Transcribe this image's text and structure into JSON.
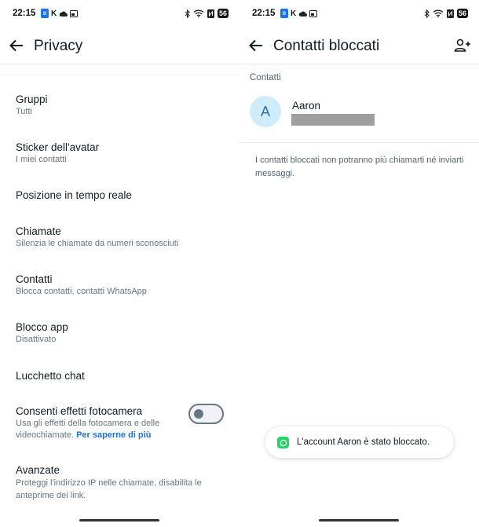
{
  "status_bar": {
    "time": "22:15",
    "battery": "56"
  },
  "left_screen": {
    "title": "Privacy",
    "items": [
      {
        "title": "Gruppi",
        "subtitle": "Tutti"
      },
      {
        "title": "Sticker dell'avatar",
        "subtitle": "I miei contatti"
      },
      {
        "title": "Posizione in tempo reale",
        "subtitle": ""
      },
      {
        "title": "Chiamate",
        "subtitle": "Silenzia le chiamate da numeri sconosciuti"
      },
      {
        "title": "Contatti",
        "subtitle": "Blocca contatti, contatti WhatsApp"
      },
      {
        "title": "Blocco app",
        "subtitle": "Disattivato"
      },
      {
        "title": "Lucchetto chat",
        "subtitle": ""
      },
      {
        "title": "Consenti effetti fotocamera",
        "subtitle": "Usa gli effetti della fotocamera e delle videochiamate.",
        "link": "Per saperne di più",
        "toggle": false
      },
      {
        "title": "Avanzate",
        "subtitle": "Proteggi l'indirizzo IP nelle chiamate, disabilita le anteprime dei link."
      }
    ]
  },
  "right_screen": {
    "title": "Contatti bloccati",
    "section_label": "Contatti",
    "contact": {
      "initial": "A",
      "name": "Aaron"
    },
    "info_text": "I contatti bloccati non potranno più chiamarti né inviarti messaggi.",
    "toast": "L'account Aaron è stato bloccato."
  },
  "icons": {
    "back": "arrow-left-icon",
    "add_contact": "person-add-icon",
    "toast_app": "whatsapp-icon"
  },
  "colors": {
    "link": "#1a73e8",
    "avatar_bg": "#d0ecfb",
    "whatsapp_green": "#25d366"
  }
}
